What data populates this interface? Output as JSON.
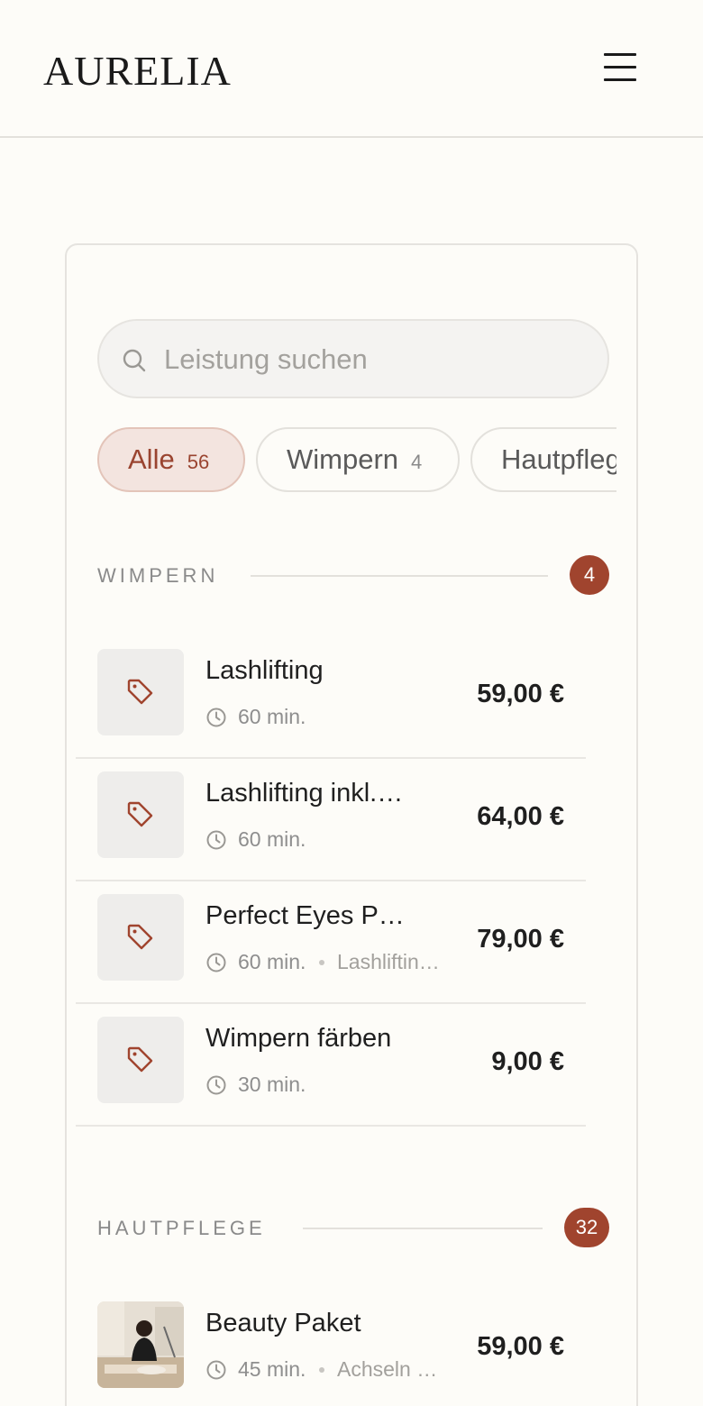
{
  "header": {
    "brand": "AURELIA"
  },
  "search": {
    "placeholder": "Leistung suchen"
  },
  "chips": [
    {
      "label": "Alle",
      "count": "56",
      "active": true
    },
    {
      "label": "Wimpern",
      "count": "4",
      "active": false
    },
    {
      "label": "Hautpfleg",
      "count": "",
      "active": false
    }
  ],
  "sections": [
    {
      "title": "WIMPERN",
      "count": "4",
      "items": [
        {
          "name": "Lashlifting",
          "duration": "60 min.",
          "extra": "",
          "price": "59,00 €"
        },
        {
          "name": "Lashlifting inkl.…",
          "duration": "60 min.",
          "extra": "",
          "price": "64,00 €"
        },
        {
          "name": "Perfect Eyes P…",
          "duration": "60 min.",
          "extra": "Lashliftin…",
          "price": "79,00 €"
        },
        {
          "name": "Wimpern färben",
          "duration": "30 min.",
          "extra": "",
          "price": "9,00 €"
        }
      ]
    },
    {
      "title": "HAUTPFLEGE",
      "count": "32",
      "items": [
        {
          "name": "Beauty Paket",
          "duration": "45 min.",
          "extra": "Achseln …",
          "price": "59,00 €"
        }
      ]
    }
  ],
  "icons": {
    "menu": "hamburger-icon",
    "search": "search-icon",
    "tag": "tag-icon",
    "clock": "clock-icon"
  },
  "colors": {
    "accent": "#a0442e",
    "background": "#fdfcf8",
    "chip_active_bg": "#f3e4df"
  }
}
